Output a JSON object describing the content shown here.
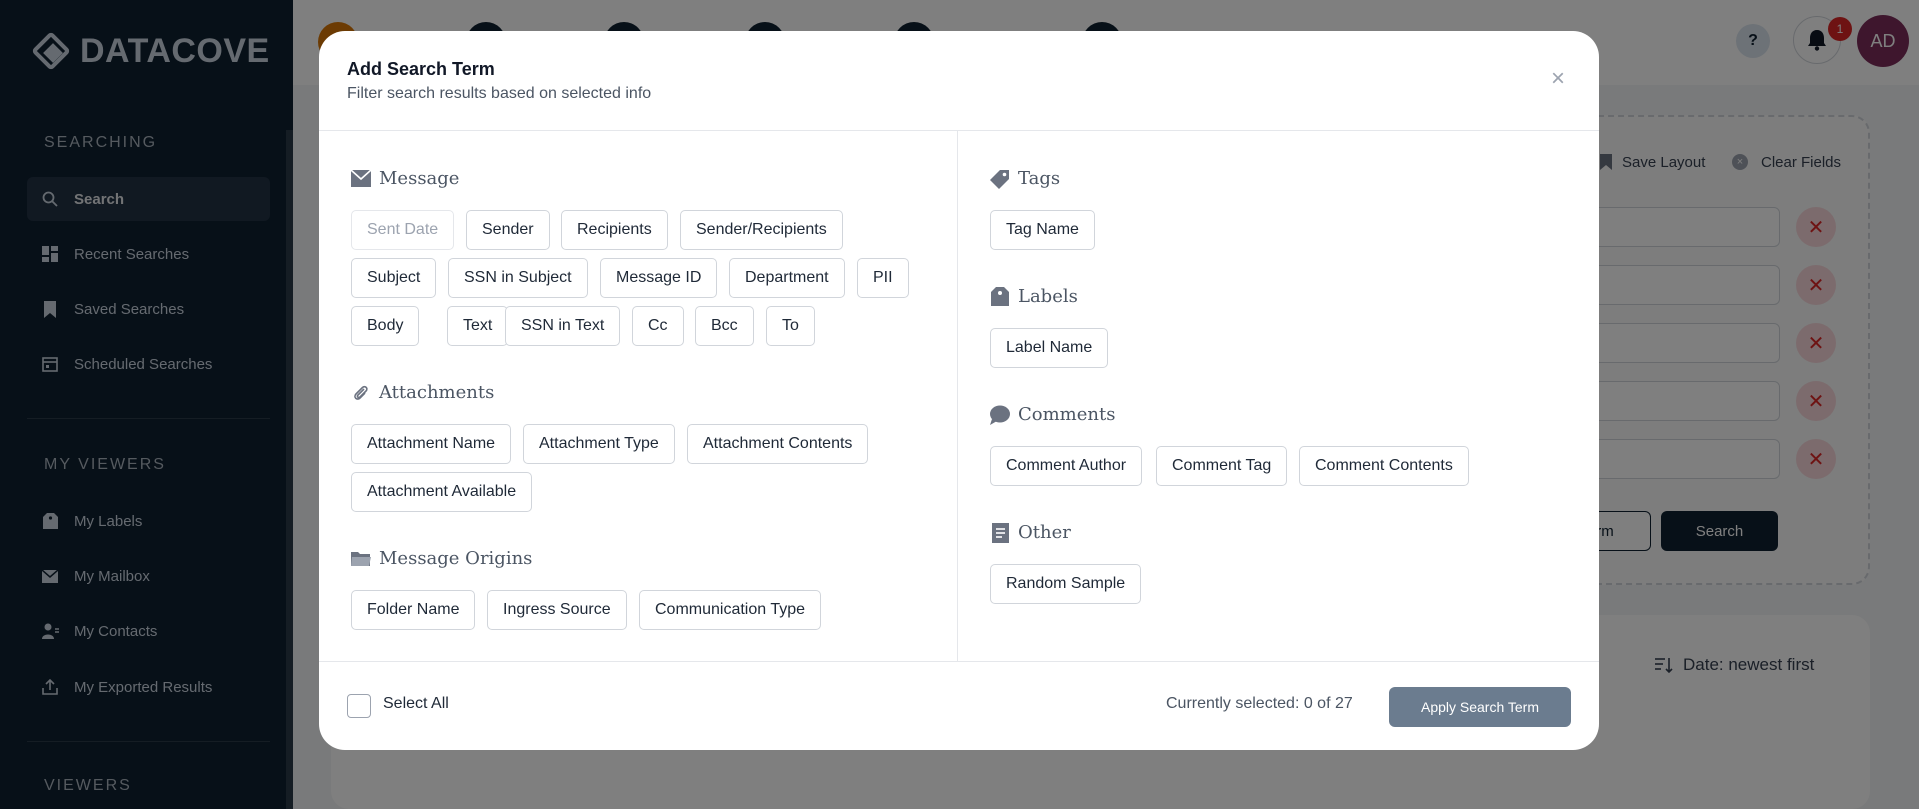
{
  "brand": {
    "name": "DATACOVE"
  },
  "sidebar": {
    "section_searching": "SEARCHING",
    "section_my_viewers": "MY VIEWERS",
    "section_viewers": "VIEWERS",
    "items": [
      {
        "label": "Search",
        "icon": "search-icon"
      },
      {
        "label": "Recent Searches",
        "icon": "dashboard-icon"
      },
      {
        "label": "Saved Searches",
        "icon": "bookmark-icon"
      },
      {
        "label": "Scheduled Searches",
        "icon": "calendar-icon"
      },
      {
        "label": "My Labels",
        "icon": "label-icon"
      },
      {
        "label": "My Mailbox",
        "icon": "mail-icon"
      },
      {
        "label": "My Contacts",
        "icon": "contacts-icon"
      },
      {
        "label": "My Exported Results",
        "icon": "export-icon"
      }
    ]
  },
  "header": {
    "help": "?",
    "notifications_count": "1",
    "avatar": "AD"
  },
  "background": {
    "save_layout": "Save Layout",
    "clear_fields": "Clear Fields",
    "add_term_partial": "rm",
    "search_button": "Search",
    "sort_label": "Date: newest first"
  },
  "modal": {
    "title": "Add Search Term",
    "subtitle": "Filter search results based on selected info",
    "close": "×",
    "groups": {
      "message": {
        "title": "Message",
        "items": [
          "Sent Date",
          "Sender",
          "Recipients",
          "Sender/Recipients",
          "Subject",
          "SSN in Subject",
          "Message ID",
          "Department",
          "PII",
          "Body",
          "Text",
          "SSN in Text",
          "Cc",
          "Bcc",
          "To"
        ]
      },
      "attachments": {
        "title": "Attachments",
        "items": [
          "Attachment Name",
          "Attachment Type",
          "Attachment Contents",
          "Attachment Available"
        ]
      },
      "origins": {
        "title": "Message Origins",
        "items": [
          "Folder Name",
          "Ingress Source",
          "Communication Type"
        ]
      },
      "tags": {
        "title": "Tags",
        "items": [
          "Tag Name"
        ]
      },
      "labels": {
        "title": "Labels",
        "items": [
          "Label Name"
        ]
      },
      "comments": {
        "title": "Comments",
        "items": [
          "Comment Author",
          "Comment Tag",
          "Comment Contents"
        ]
      },
      "other": {
        "title": "Other",
        "items": [
          "Random Sample"
        ]
      }
    },
    "footer": {
      "select_all": "Select All",
      "selected_count": "Currently selected: 0 of 27",
      "apply": "Apply Search Term"
    }
  },
  "colors": {
    "sidebar_bg": "#0f2030",
    "apply_button": "#6b7c8f",
    "danger": "#dc2626"
  }
}
